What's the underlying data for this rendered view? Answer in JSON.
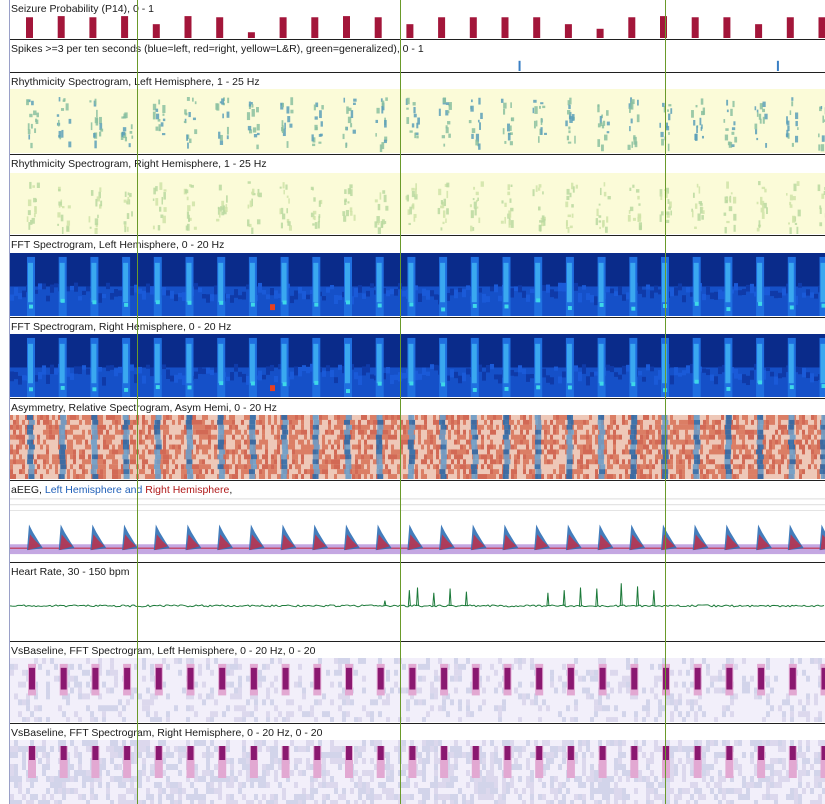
{
  "panels": [
    {
      "id": "seizure",
      "title": "Seizure Probability (P14), 0 - 1"
    },
    {
      "id": "spikes",
      "title": "Spikes >=3 per ten seconds (blue=left, red=right, yellow=L&R), green=generalized),  0 - 1"
    },
    {
      "id": "rhythm_left",
      "title": "Rhythmicity Spectrogram, Left Hemisphere, 1 - 25 Hz"
    },
    {
      "id": "rhythm_right",
      "title": "Rhythmicity Spectrogram, Right Hemisphere, 1 - 25 Hz"
    },
    {
      "id": "fft_left",
      "title": "FFT Spectrogram, Left Hemisphere, 0 - 20 Hz"
    },
    {
      "id": "fft_right",
      "title": "FFT Spectrogram, Right Hemisphere, 0 - 20 Hz"
    },
    {
      "id": "asym",
      "title": "Asymmetry, Relative Spectrogram, Asym Hemi, 0 - 20 Hz"
    },
    {
      "id": "aeeg",
      "title_prefix": "aEEG, ",
      "title_left": "Left Hemisphere",
      "title_and": " and ",
      "title_right": "Right Hemisphere",
      "title_suffix": ","
    },
    {
      "id": "hr",
      "title": "Heart Rate, 30 - 150 bpm"
    },
    {
      "id": "vs_left",
      "title": "VsBaseline, FFT Spectrogram, Left Hemisphere, 0 - 20 Hz, 0 - 20"
    },
    {
      "id": "vs_right",
      "title": "VsBaseline, FFT Spectrogram, Right Hemisphere, 0 - 20 Hz, 0 - 20"
    }
  ],
  "colors": {
    "seizure_bar": "#a3163a",
    "spike_blue": "#3a7fc4",
    "rhythm_bg": "#fbfbd8",
    "fft_bg": "#0a2b8a",
    "fft_mid": "#1f6fe0",
    "fft_hot": "#3ed8e8",
    "asym_red": "#d4654a",
    "asym_blue": "#2e6aa8",
    "aeeg_left": "#2f6fb5",
    "aeeg_right": "#c0304a",
    "aeeg_band": "#b08ad8",
    "hr_line": "#1c7a3a",
    "vs_bg": "#f2effa",
    "vs_hot": "#8a1870",
    "cursor": "#6a9a2a"
  },
  "series": {
    "seizure_probability": [
      0.9,
      0.95,
      0.9,
      0.95,
      0.6,
      0.95,
      0.9,
      0.25,
      0.9,
      0.9,
      0.95,
      0.9,
      0.6,
      0.9,
      0.9,
      0.9,
      0.9,
      0.6,
      0.4,
      0.9,
      0.95,
      0.9,
      0.9,
      0.6,
      0.9,
      0.9
    ],
    "spikes": [
      {
        "position": 0.624,
        "level": 0.6
      },
      {
        "position": 0.941,
        "level": 0.6
      }
    ],
    "heart_rate_baseline": 95,
    "heart_rate_peaks": [
      [
        0.46,
        105
      ],
      [
        0.49,
        125
      ],
      [
        0.5,
        130
      ],
      [
        0.52,
        120
      ],
      [
        0.54,
        128
      ],
      [
        0.56,
        122
      ],
      [
        0.66,
        120
      ],
      [
        0.68,
        125
      ],
      [
        0.7,
        130
      ],
      [
        0.72,
        128
      ],
      [
        0.75,
        138
      ],
      [
        0.77,
        132
      ],
      [
        0.79,
        125
      ]
    ]
  }
}
